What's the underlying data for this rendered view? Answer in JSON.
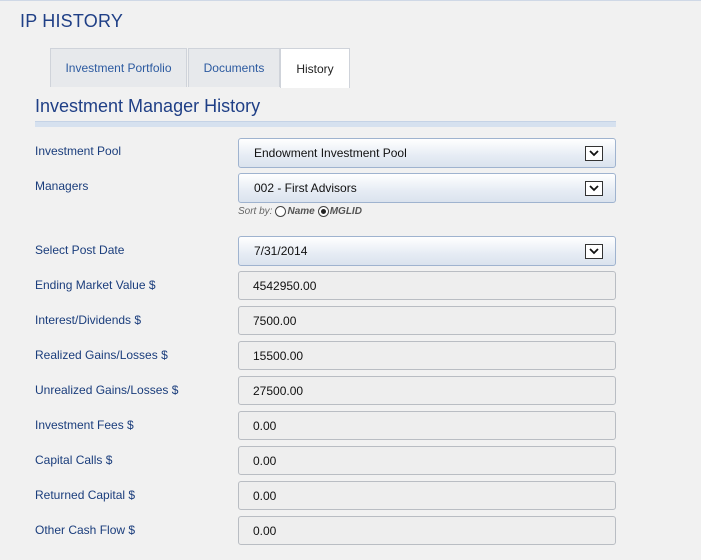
{
  "page": {
    "title": "IP HISTORY"
  },
  "tabs": [
    {
      "label": "Investment Portfolio"
    },
    {
      "label": "Documents"
    },
    {
      "label": "History"
    }
  ],
  "active_tab": "History",
  "section": {
    "title": "Investment Manager History"
  },
  "fields": {
    "investment_pool": {
      "label": "Investment Pool",
      "value": "Endowment Investment Pool"
    },
    "managers": {
      "label": "Managers",
      "value": "002 - First Advisors"
    },
    "sort_by": {
      "label": "Sort by:",
      "options": [
        "Name",
        "MGLID"
      ],
      "selected": "MGLID"
    },
    "post_date": {
      "label": "Select Post Date",
      "value": "7/31/2014"
    },
    "ending_market_value": {
      "label": "Ending Market Value $",
      "value": "4542950.00"
    },
    "interest_dividends": {
      "label": "Interest/Dividends $",
      "value": "7500.00"
    },
    "realized_gains": {
      "label": "Realized Gains/Losses $",
      "value": "15500.00"
    },
    "unrealized_gains": {
      "label": "Unrealized Gains/Losses $",
      "value": "27500.00"
    },
    "investment_fees": {
      "label": "Investment Fees $",
      "value": "0.00"
    },
    "capital_calls": {
      "label": "Capital Calls $",
      "value": "0.00"
    },
    "returned_capital": {
      "label": "Returned Capital $",
      "value": "0.00"
    },
    "other_cash_flow": {
      "label": "Other Cash Flow $",
      "value": "0.00"
    }
  },
  "icons": {
    "dropdown": "chevron-down-icon"
  }
}
